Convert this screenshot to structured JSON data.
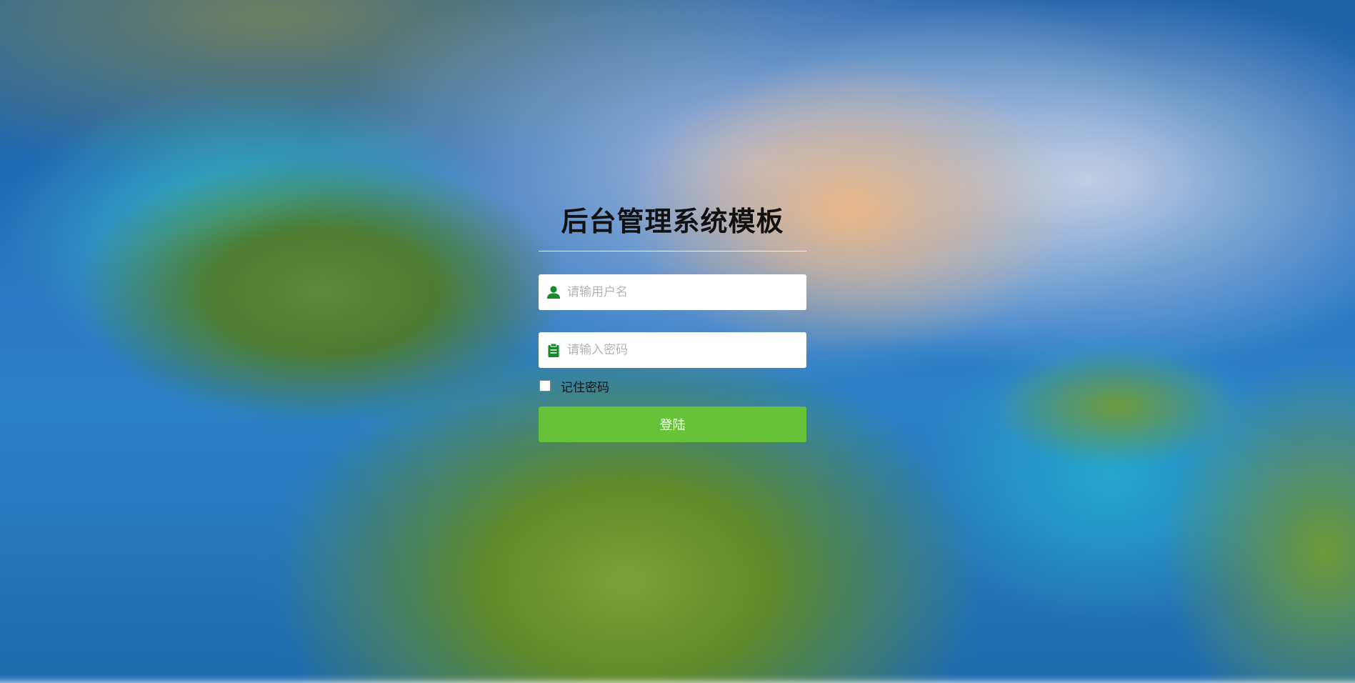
{
  "login": {
    "title": "后台管理系统模板",
    "username": {
      "placeholder": "请输用户名",
      "value": "",
      "icon": "user-icon"
    },
    "password": {
      "placeholder": "请输入密码",
      "value": "",
      "icon": "clipboard-icon"
    },
    "remember_label": "记住密码",
    "remember_checked": false,
    "submit_label": "登陆"
  },
  "colors": {
    "accent": "#67c23a",
    "icon": "#168a2b"
  }
}
